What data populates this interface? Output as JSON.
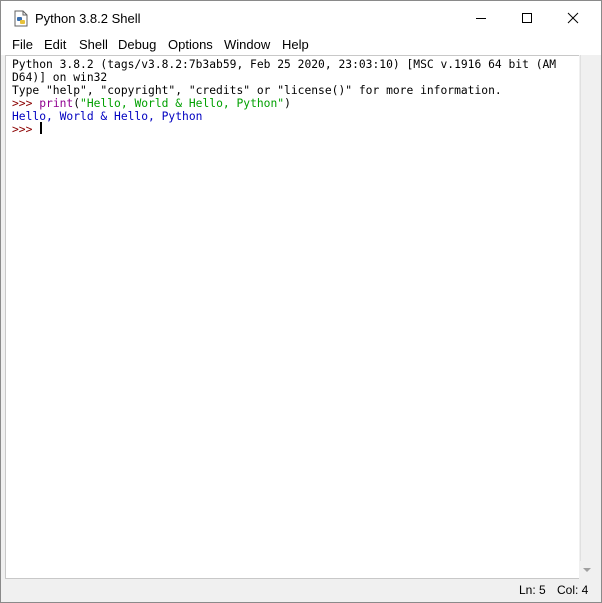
{
  "window": {
    "title": "Python 3.8.2 Shell",
    "app_icon": "python-idle-icon"
  },
  "window_controls": {
    "minimize_icon": "minimize-icon",
    "maximize_icon": "maximize-icon",
    "close_icon": "close-icon"
  },
  "menu": {
    "items": [
      "File",
      "Edit",
      "Shell",
      "Debug",
      "Options",
      "Window",
      "Help"
    ]
  },
  "shell": {
    "banner_line1": "Python 3.8.2 (tags/v3.8.2:7b3ab59, Feb 25 2020, 23:03:10) [MSC v.1916 64 bit (AM",
    "banner_line2": "D64)] on win32",
    "banner_line3": "Type \"help\", \"copyright\", \"credits\" or \"license()\" for more information.",
    "prompt1": ">>> ",
    "cmd_builtin": "print",
    "cmd_open": "(",
    "cmd_string": "\"Hello, World & Hello, Python\"",
    "cmd_close": ")",
    "output": "Hello, World & Hello, Python",
    "prompt2": ">>> "
  },
  "status": {
    "line": "Ln: 5",
    "col": "Col: 4"
  },
  "colors": {
    "prompt": "#8b0000",
    "builtin": "#900090",
    "string": "#00a000",
    "output": "#0000c0"
  }
}
